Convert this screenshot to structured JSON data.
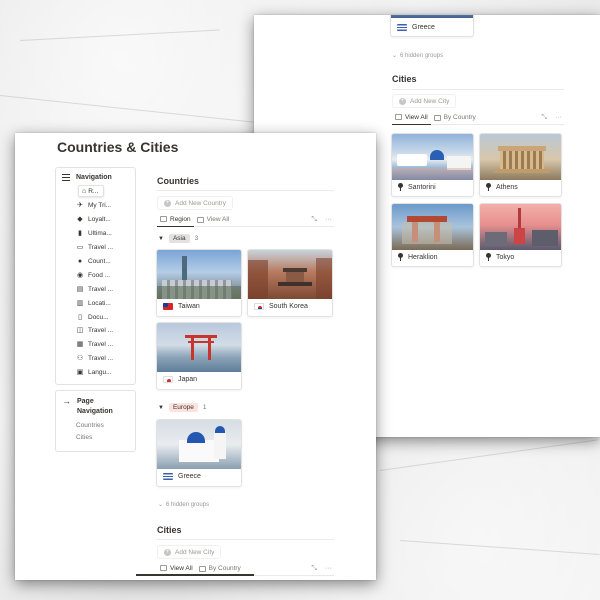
{
  "page": {
    "title": "Countries & Cities"
  },
  "navigation": {
    "header": "Navigation",
    "items": [
      {
        "icon": "home-icon",
        "label": "R..."
      },
      {
        "icon": "airplane-icon",
        "label": "My Tri..."
      },
      {
        "icon": "tag-icon",
        "label": "Loyalt..."
      },
      {
        "icon": "book-icon",
        "label": "Ultima..."
      },
      {
        "icon": "car-icon",
        "label": "Travel ..."
      },
      {
        "icon": "globe-icon",
        "label": "Count..."
      },
      {
        "icon": "food-icon",
        "label": "Food ..."
      },
      {
        "icon": "document-icon",
        "label": "Travel ..."
      },
      {
        "icon": "map-icon",
        "label": "Locati..."
      },
      {
        "icon": "file-icon",
        "label": "Docu..."
      },
      {
        "icon": "open-book-icon",
        "label": "Travel ..."
      },
      {
        "icon": "calendar-icon",
        "label": "Travel ..."
      },
      {
        "icon": "people-icon",
        "label": "Travel ..."
      },
      {
        "icon": "translate-icon",
        "label": "Langu..."
      }
    ]
  },
  "page_navigation": {
    "header_line1": "Page",
    "header_line2": "Navigation",
    "links": [
      "Countries",
      "Cities"
    ]
  },
  "countries": {
    "title": "Countries",
    "add_label": "Add New Country",
    "tabs": [
      "Region",
      "View All"
    ],
    "groups": [
      {
        "name": "Asia",
        "count": "3",
        "tag_color": "#e3e2e0",
        "cards": [
          {
            "name": "Taiwan",
            "flag": "taiwan-flag-icon"
          },
          {
            "name": "South Korea",
            "flag": "south-korea-flag-icon"
          },
          {
            "name": "Japan",
            "flag": "japan-flag-icon"
          }
        ]
      },
      {
        "name": "Europe",
        "count": "1",
        "tag_color": "#ffe2dd",
        "cards": [
          {
            "name": "Greece",
            "flag": "greece-flag-icon"
          }
        ]
      }
    ],
    "hidden_groups": "6 hidden groups"
  },
  "cities_front": {
    "title": "Cities",
    "add_label": "Add New City",
    "tabs": [
      "View All",
      "By Country"
    ]
  },
  "back_sheet": {
    "greece_card": "Greece",
    "hidden_groups": "6 hidden groups",
    "cities": {
      "title": "Cities",
      "add_label": "Add New City",
      "tabs": [
        "View All",
        "By Country"
      ],
      "cards": [
        "Santorini",
        "Athens",
        "Heraklion",
        "Tokyo"
      ]
    }
  },
  "toolbar": {
    "expand_icon": "expand-icon",
    "more_icon": "more-icon",
    "more_label": "···"
  }
}
